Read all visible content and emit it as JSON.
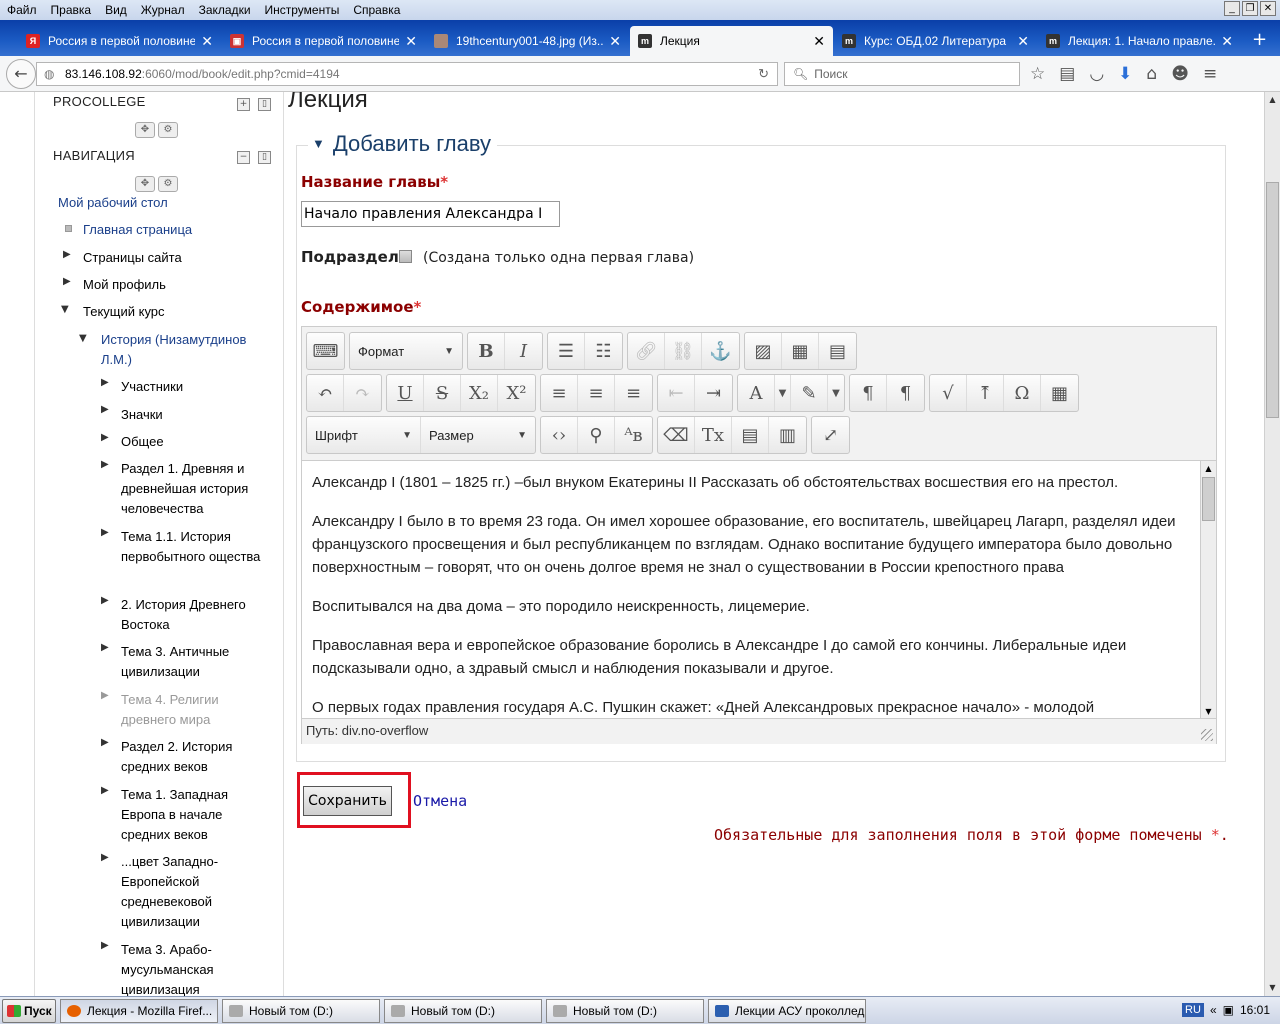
{
  "menubar": {
    "items": [
      "Файл",
      "Правка",
      "Вид",
      "Журнал",
      "Закладки",
      "Инструменты",
      "Справка"
    ],
    "window_controls": [
      "_",
      "❐",
      "✕"
    ]
  },
  "tabs": [
    {
      "label": "Россия в первой половине...",
      "icon": "yandex-icon",
      "active": false
    },
    {
      "label": "Россия в первой половине...",
      "icon": "page-icon",
      "active": false
    },
    {
      "label": "19thcentury001-48.jpg (Из...",
      "icon": "image-icon",
      "active": false
    },
    {
      "label": "Лекция",
      "icon": "moodle-icon",
      "active": true
    },
    {
      "label": "Курс: ОБД.02 Литература",
      "icon": "moodle-icon",
      "active": false
    },
    {
      "label": "Лекция: 1. Начало правле...",
      "icon": "moodle-icon",
      "active": false
    }
  ],
  "navbar": {
    "url_host": "83.146.108.92",
    "url_rest": ":6060/mod/book/edit.php?cmid=4194",
    "search_placeholder": "Поиск"
  },
  "sidebar": {
    "block1_title": "PROCOLLEGE",
    "block2_title": "НАВИГАЦИЯ",
    "items": [
      {
        "label": "Мой рабочий стол",
        "style": "blue"
      },
      {
        "label": "Главная страница",
        "style": "blue"
      },
      {
        "label": "Страницы сайта",
        "style": "normal"
      },
      {
        "label": "Мой профиль",
        "style": "normal"
      },
      {
        "label": "Текущий курс",
        "style": "normal"
      },
      {
        "label": "История (Низамутдинов Л.М.)",
        "style": "blue"
      },
      {
        "label": "Участники",
        "style": "normal"
      },
      {
        "label": "Значки",
        "style": "normal"
      },
      {
        "label": "Общее",
        "style": "normal"
      },
      {
        "label": "Раздел 1. Древняя и древнейшая история человечества",
        "style": "normal"
      },
      {
        "label": "Тема 1.1. История первобытного ощества",
        "style": "normal"
      },
      {
        "label": "2. История Древнего Востока",
        "style": "normal"
      },
      {
        "label": "Тема 3. Античные цивилизации",
        "style": "normal"
      },
      {
        "label": "Тема 4. Религии древнего мира",
        "style": "dim"
      },
      {
        "label": "Раздел 2. История средних веков",
        "style": "normal"
      },
      {
        "label": "Тема 1. Западная Европа в начале средних веков",
        "style": "normal"
      },
      {
        "label": "...цвет Западно-Европейской средневековой цивилизации",
        "style": "normal"
      },
      {
        "label": "Тема 3. Арабо-мусульманская цивилизация",
        "style": "normal"
      }
    ]
  },
  "main": {
    "page_title": "Лекция",
    "section_title": "Добавить главу",
    "chapter_title_label": "Название главы",
    "chapter_title_value": "Начало правления Александра I",
    "subchapter_label": "Подраздел",
    "subchapter_note": "(Создана только одна первая глава)",
    "content_label": "Содержимое",
    "required_mark": "*",
    "editor": {
      "format_label": "Формат",
      "font_label": "Шрифт",
      "size_label": "Размер",
      "paragraphs": [
        "Александр I (1801 – 1825 гг.) –был внуком Екатерины II Рассказать об обстоятельствах восшествия его на престол.",
        "Александру I было в то время 23 года. Он имел хорошее образование, его воспитатель, швейцарец Лагарп, разделял идеи французского просвещения и был республиканцем по взглядам. Однако воспитание будущего императора было довольно поверхностным – говорят, что он очень долгое время не знал о существовании в России крепостного права",
        "Воспитывался на два дома – это породило неискренность, лицемерие.",
        "Православная вера и европейское образование боролись в Александре I до самой его кончины. Либеральные идеи подсказывали одно, а здравый смысл и наблюдения показывали и другое.",
        "О первых годах правления государя А.С. Пушкин скажет: «Дней Александровых прекрасное начало» - молодой"
      ],
      "path_text": "Путь: div.no-overflow"
    },
    "save_label": "Сохранить",
    "cancel_label": "Отмена",
    "required_note": "Обязательные для заполнения поля в этой форме помечены",
    "required_note_end": "."
  },
  "taskbar": {
    "start_label": "Пуск",
    "buttons": [
      {
        "label": "Лекция - Mozilla Firef...",
        "active": true
      },
      {
        "label": "Новый том (D:)",
        "active": false
      },
      {
        "label": "Новый том (D:)",
        "active": false
      },
      {
        "label": "Новый том (D:)",
        "active": false
      },
      {
        "label": "Лекции АСУ проколлед...",
        "active": false
      }
    ],
    "lang": "RU",
    "tray_expand": "«",
    "clock": "16:01"
  },
  "colors": {
    "required_label": "#8b0000",
    "link_blue": "#1a3f8a",
    "highlight_box": "#e01020",
    "tab_strip": "#1c5cc4"
  }
}
